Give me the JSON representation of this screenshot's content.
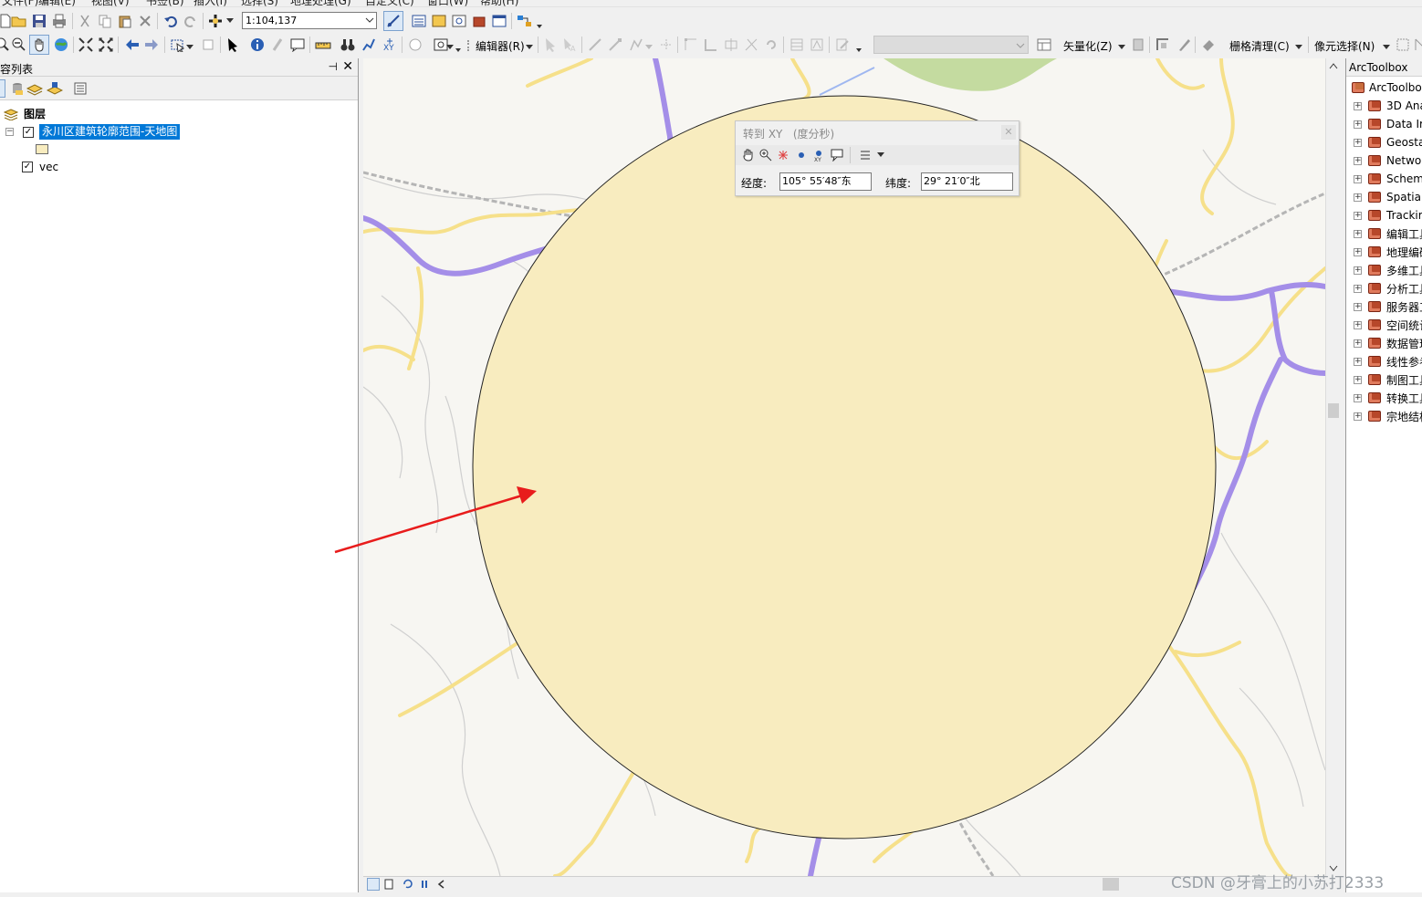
{
  "menu": {
    "items": [
      "文件(F)",
      "编辑(E)",
      "视图(V)",
      "书签(B)",
      "插入(I)",
      "选择(S)",
      "地理处理(G)",
      "自定义(C)",
      "窗口(W)",
      "帮助(H)"
    ]
  },
  "toolbar": {
    "scale_value": "1:104,137",
    "editor_label": "编辑器(R)",
    "vectorize_label": "矢量化(Z)",
    "raster_cleanup_label": "栅格清理(C)",
    "cell_select_label": "像元选择(N)"
  },
  "toc": {
    "title": "容列表",
    "root_label": "图层",
    "layers": [
      {
        "name": "永川区建筑轮廓范围-天地图",
        "checked": true,
        "selected": true,
        "symbol_color": "#f8ecbf"
      },
      {
        "name": "vec",
        "checked": true,
        "selected": false
      }
    ]
  },
  "goto_xy": {
    "title": "转到 XY",
    "units": "(度分秒)",
    "longitude_label": "经度:",
    "longitude_value": "105° 55′48″东",
    "latitude_label": "纬度:",
    "latitude_value": "29° 21′0″北"
  },
  "toolbox": {
    "title": "ArcToolbox",
    "root_label": "ArcToolbo",
    "items": [
      "3D Ana",
      "Data Ir",
      "Geosta",
      "Netwo",
      "Schem",
      "Spatial",
      "Trackir",
      "编辑工具",
      "地理编码",
      "多维工具",
      "分析工具",
      "服务器工",
      "空间统计",
      "数据管理",
      "线性参考",
      "制图工具",
      "转换工具",
      "宗地结构"
    ]
  },
  "map": {
    "circle_fill": "#f8ecbf",
    "road_major_color": "#a48ee8",
    "road_minor_color": "#f6e08a",
    "arrow_color": "#e81c1c"
  },
  "watermark": "CSDN @牙膏上的小苏打2333"
}
